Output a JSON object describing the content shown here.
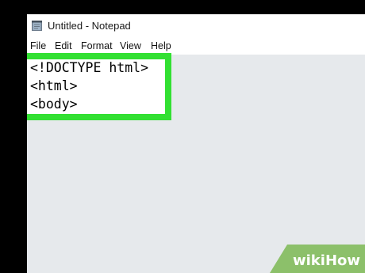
{
  "window": {
    "title": "Untitled - Notepad",
    "icon": "notepad-icon"
  },
  "menubar": {
    "items": [
      "File",
      "Edit",
      "Format",
      "View",
      "Help"
    ]
  },
  "editor": {
    "lines": [
      "<!DOCTYPE html>",
      "<html>",
      "<body>"
    ]
  },
  "colors": {
    "highlight": "#32e032",
    "editor_background": "#e6e9ec",
    "watermark_background": "#8cc06a"
  },
  "watermark": {
    "text": "wikiHow"
  }
}
